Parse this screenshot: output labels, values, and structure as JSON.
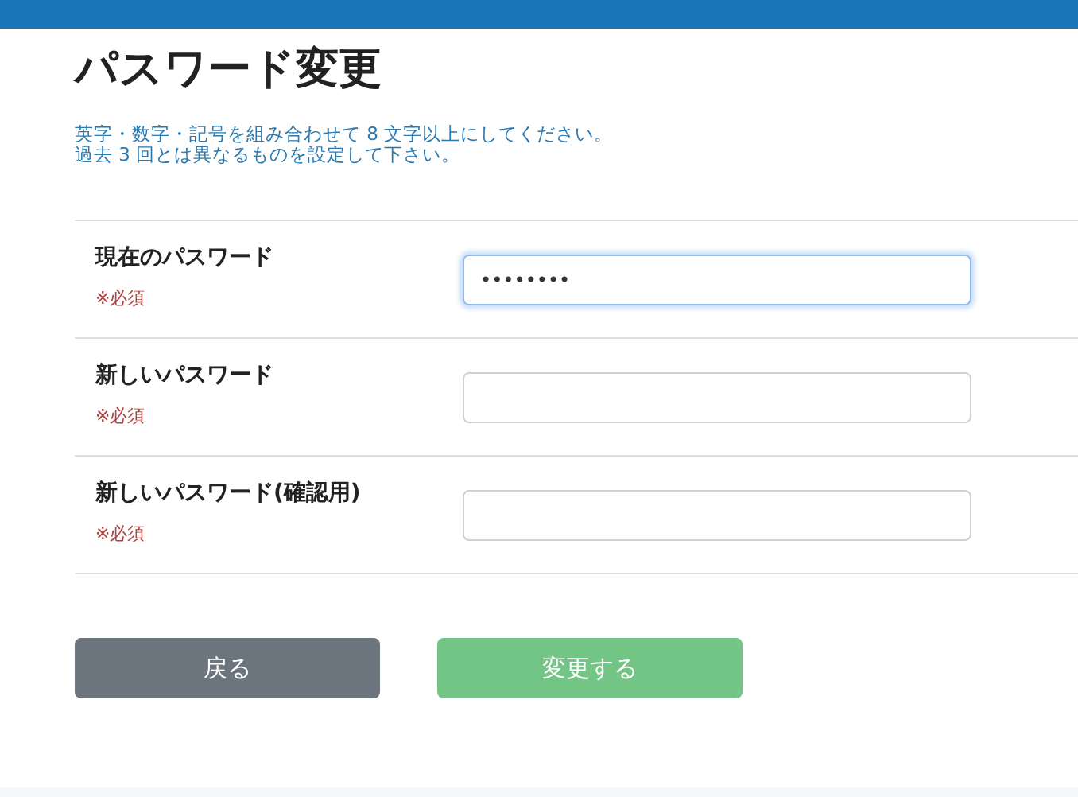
{
  "title": "パスワード変更",
  "notes": [
    "英字・数字・記号を組み合わせて 8 文字以上にしてください。",
    "過去 3 回とは異なるものを設定して下さい。"
  ],
  "fields": [
    {
      "label": "現在のパスワード",
      "required": "※必須",
      "value": "••••••••",
      "focused": true
    },
    {
      "label": "新しいパスワード",
      "required": "※必須",
      "focused": false
    },
    {
      "label": "新しいパスワード(確認用)",
      "required": "※必須",
      "focused": false
    }
  ],
  "buttons": [
    {
      "label": "戻る",
      "kind": "back",
      "disabled": false
    },
    {
      "label": "変更する",
      "kind": "submit",
      "disabled": true
    }
  ]
}
